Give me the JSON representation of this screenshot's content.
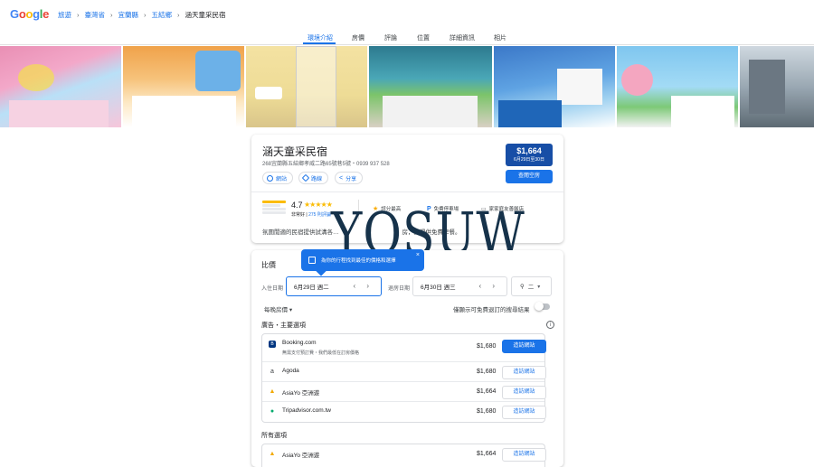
{
  "header": {
    "logo_letters": [
      "G",
      "o",
      "o",
      "g",
      "l",
      "e"
    ],
    "breadcrumb": [
      "旅遊",
      "臺灣省",
      "宜蘭縣",
      "五結鄉",
      "涵天童采民宿"
    ]
  },
  "tabs": [
    "環境介紹",
    "房價",
    "評論",
    "位置",
    "詳細資訊",
    "相片"
  ],
  "hotel": {
    "name": "涵天童采民宿",
    "address": "268宜蘭縣五結鄉孝威二路65號巷5號・0939 937 528",
    "actions": [
      "網站",
      "路線",
      "分享"
    ],
    "price": "$1,664",
    "price_dates": "6月29日至30日",
    "check_button": "查閱空房",
    "rating": "4.7",
    "stars": "★★★★★",
    "rating_label": "非常好",
    "review_count": "275 則評論",
    "amenities": [
      "評分最高",
      "免費停車場",
      "家家庭友善飯店"
    ],
    "description": "氛圍閒適的民宿提供試溝各…",
    "desc_tail": "房，並提供免費早餐。"
  },
  "watermark": "YOSUW",
  "prices": {
    "title": "比價",
    "tooltip": "為你的行程找到最佳的價格和選擇",
    "tooltip_close": "×",
    "checkin_label": "入住日期",
    "checkin_value": "6月29日 週二",
    "checkout_label": "退房日期",
    "checkout_value": "6月30日 週三",
    "guests": "二",
    "sort": "每晚房價",
    "free_cancel": "僅顯示可免費退訂的搜尋結果",
    "ads_heading": "廣告・主要選項",
    "all_heading": "所有選項",
    "offers": [
      {
        "name": "Booking.com",
        "sub": "無需支付預訂費・我們最低在訂房價格",
        "price": "$1,680",
        "button": "造訪網站",
        "logo": "B",
        "color": "#003580"
      },
      {
        "name": "Agoda",
        "sub": "",
        "price": "$1,680",
        "button": "造訪網站",
        "logo": "a",
        "color": "#5f6368"
      },
      {
        "name": "AsiaYo 亞洲遊",
        "sub": "",
        "price": "$1,664",
        "button": "造訪網站",
        "logo": "▲",
        "color": "#f2a900"
      },
      {
        "name": "Tripadvisor.com.tw",
        "sub": "",
        "price": "$1,680",
        "button": "造訪網站",
        "logo": "●",
        "color": "#00aa6c"
      }
    ],
    "all_first": {
      "name": "AsiaYo 亞洲遊",
      "price": "$1,664",
      "button": "造訪網站"
    }
  }
}
